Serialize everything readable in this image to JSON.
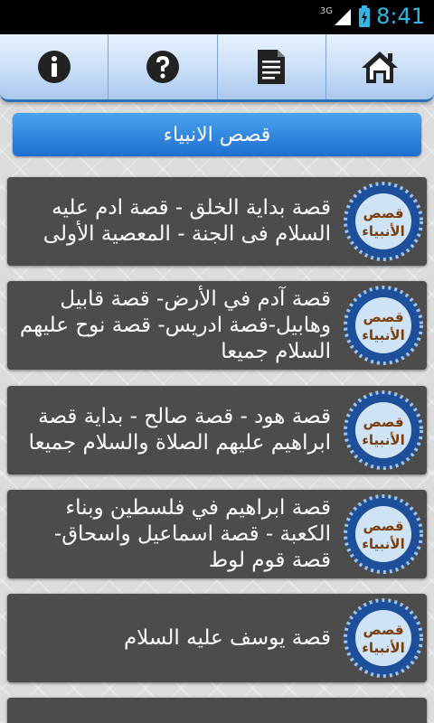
{
  "status": {
    "network": "3G",
    "time": "8:41"
  },
  "toolbar": {
    "buttons": [
      {
        "icon": "info-icon"
      },
      {
        "icon": "help-icon"
      },
      {
        "icon": "document-icon"
      },
      {
        "icon": "home-icon"
      }
    ]
  },
  "title": "قصص الانبياء",
  "icon_label": "قصص الأنبياء",
  "items": [
    {
      "text": "قصة بداية الخلق - قصة ادم عليه السلام فى الجنة - المعصية الأولى"
    },
    {
      "text": "قصة آدم في الأرض- قصة قابيل وهابيل-قصة ادريس- قصة نوح عليهم السلام جميعا"
    },
    {
      "text": "قصة هود - قصة صالح - بداية قصة ابراهيم عليهم الصلاة والسلام جميعا"
    },
    {
      "text": "قصة ابراهيم في فلسطين وبناء الكعبة - قصة اسماعيل واسحاق- قصة قوم لوط"
    },
    {
      "text": "قصة يوسف عليه السلام"
    }
  ],
  "colors": {
    "accent": "#2d6fb8",
    "title_bar": "#1e6fd0",
    "card_bg": "#4c4c4c",
    "status_text": "#33b5e5"
  }
}
